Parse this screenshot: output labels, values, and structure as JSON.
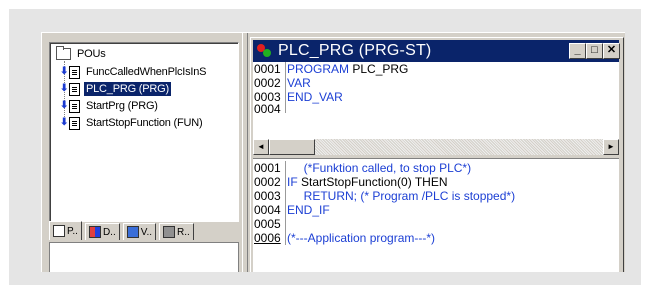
{
  "tree": {
    "root_label": "POUs",
    "items": [
      {
        "label": "FuncCalledWhenPlcIsInS",
        "selected": false
      },
      {
        "label": "PLC_PRG (PRG)",
        "selected": true
      },
      {
        "label": "StartPrg (PRG)",
        "selected": false
      },
      {
        "label": "StartStopFunction (FUN)",
        "selected": false
      }
    ]
  },
  "tabs": [
    {
      "label": "P..",
      "icon": "pou-icon"
    },
    {
      "label": "D..",
      "icon": "datatypes-icon"
    },
    {
      "label": "V..",
      "icon": "visualization-icon"
    },
    {
      "label": "R..",
      "icon": "resources-icon"
    }
  ],
  "editor": {
    "title": "PLC_PRG (PRG-ST)",
    "window_buttons": {
      "minimize": "_",
      "maximize": "□",
      "close": "✕"
    },
    "declaration": [
      {
        "line": "0001",
        "text": "PROGRAM PLC_PRG",
        "kw": "PROGRAM",
        "rest": " PLC_PRG"
      },
      {
        "line": "0002",
        "text": "VAR",
        "kw": "VAR",
        "rest": ""
      },
      {
        "line": "0003",
        "text": "END_VAR",
        "kw": "END_VAR",
        "rest": ""
      },
      {
        "line": "0004",
        "text": "",
        "kw": "",
        "rest": ""
      }
    ],
    "body": [
      {
        "line": "0001",
        "pre": "     ",
        "kw": "",
        "rest": "(*Funktion called, to stop PLC*)"
      },
      {
        "line": "0002",
        "pre": "",
        "kw": "IF",
        "rest": " StartStopFunction(0) THEN"
      },
      {
        "line": "0003",
        "pre": "     ",
        "kw": "RETURN",
        "rest": "; (* Program /PLC is stopped*)"
      },
      {
        "line": "0004",
        "pre": "",
        "kw": "END_IF",
        "rest": ""
      },
      {
        "line": "0005",
        "pre": "",
        "kw": "",
        "rest": ""
      },
      {
        "line": "0006",
        "pre": "",
        "kw": "",
        "rest": "(*---Application program---*)"
      }
    ],
    "scroll": {
      "left": "◄",
      "right": "►"
    }
  },
  "colors": {
    "title_bar": "#0a246a",
    "keyword": "#1c3fd4",
    "selection": "#0a246a",
    "chrome": "#d4d0c8"
  }
}
